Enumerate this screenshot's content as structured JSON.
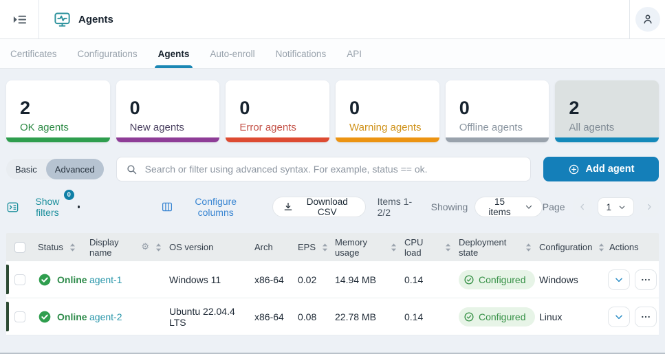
{
  "header": {
    "title": "Agents",
    "app_icon": "monitor-pulse-icon",
    "menu_icon": "sidebar-expand-icon",
    "user_icon": "person-icon"
  },
  "tabs": [
    {
      "label": "Certificates",
      "active": false
    },
    {
      "label": "Configurations",
      "active": false
    },
    {
      "label": "Agents",
      "active": true
    },
    {
      "label": "Auto-enroll",
      "active": false
    },
    {
      "label": "Notifications",
      "active": false
    },
    {
      "label": "API",
      "active": false
    }
  ],
  "stats": [
    {
      "value": "2",
      "label": "OK agents",
      "label_color": "#2e8b46",
      "strip_color": "#2f9e4e",
      "selected": false
    },
    {
      "value": "0",
      "label": "New agents",
      "label_color": "#4a4060",
      "strip_color": "#8e3d97",
      "selected": false
    },
    {
      "value": "0",
      "label": "Error agents",
      "label_color": "#c45248",
      "strip_color": "#dd4b32",
      "selected": false
    },
    {
      "value": "0",
      "label": "Warning agents",
      "label_color": "#cf9118",
      "strip_color": "#ec9413",
      "selected": false
    },
    {
      "value": "0",
      "label": "Offline agents",
      "label_color": "#8a95a0",
      "strip_color": "#99a2ac",
      "selected": false
    },
    {
      "value": "2",
      "label": "All agents",
      "label_color": "#7f8a94",
      "strip_color": "#1489ba",
      "selected": true
    }
  ],
  "filter_bar": {
    "mode_basic": "Basic",
    "mode_advanced": "Advanced",
    "search_placeholder": "Search or filter using advanced syntax. For example, status == ok.",
    "add_agent_label": "Add agent"
  },
  "toolbar": {
    "show_filters_label": "Show filters",
    "filters_badge": "0",
    "configure_columns_label": "Configure columns",
    "download_csv_label": "Download CSV",
    "items_text": "Items 1-2/2",
    "showing_label": "Showing",
    "page_size_value": "15 items",
    "page_label": "Page",
    "page_value": "1"
  },
  "table": {
    "columns": [
      {
        "label": "Status"
      },
      {
        "label": "Display name"
      },
      {
        "label": "OS version"
      },
      {
        "label": "Arch"
      },
      {
        "label": "EPS"
      },
      {
        "label": "Memory usage"
      },
      {
        "label": "CPU load"
      },
      {
        "label": "Deployment state"
      },
      {
        "label": "Configuration"
      },
      {
        "label": "Actions"
      }
    ],
    "rows": [
      {
        "status": "Online",
        "display_name": "agent-1",
        "os_version": "Windows 11",
        "arch": "x86-64",
        "eps": "0.02",
        "memory_usage": "14.94 MB",
        "cpu_load": "0.14",
        "deployment_state": "Configured",
        "configuration": "Windows"
      },
      {
        "status": "Online",
        "display_name": "agent-2",
        "os_version": "Ubuntu 22.04.4 LTS",
        "arch": "x86-64",
        "eps": "0.08",
        "memory_usage": "22.78 MB",
        "cpu_load": "0.14",
        "deployment_state": "Configured",
        "configuration": "Linux"
      }
    ]
  },
  "colors": {
    "accent_blue": "#147fb9",
    "active_tab_underline": "#1b87b4",
    "teal_action": "#1b8f9c",
    "link_blue": "#3a86d2",
    "agent_link_teal": "#2795a9",
    "online_green": "#2e8b4a",
    "configured_green": "#359045",
    "badge_bg": "#0f7fa6",
    "page_bg": "#edf1f6"
  }
}
